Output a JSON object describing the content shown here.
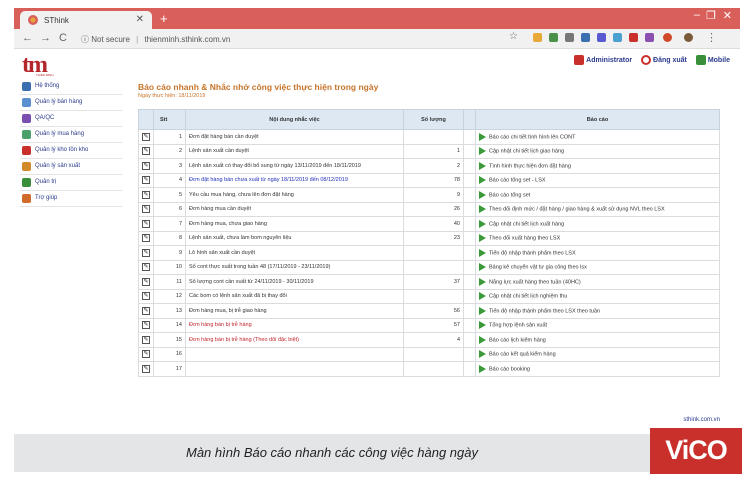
{
  "browser": {
    "tab_title": "SThink",
    "new_tab": "+",
    "nav_back": "←",
    "nav_forward": "→",
    "nav_reload": "C",
    "security": "Not secure",
    "url": "thienminh.sthink.com.vn",
    "minimize": "–",
    "restore": "❐",
    "close": "✕"
  },
  "header": {
    "logo_text": "tm",
    "logo_sub": "THIEN MINH",
    "admin": "Administrator",
    "logout": "Đăng xuất",
    "mobile": "Mobile"
  },
  "sidebar": {
    "items": [
      {
        "label": "Hệ thống",
        "icon": "tools-icon",
        "color": "#3a6fb0"
      },
      {
        "label": "Quản lý bán hàng",
        "icon": "sales-icon",
        "color": "#5a8fd0"
      },
      {
        "label": "QA/QC",
        "icon": "qaqc-icon",
        "color": "#7a4fb0"
      },
      {
        "label": "Quản lý mua hàng",
        "icon": "purchase-icon",
        "color": "#4a9f6a"
      },
      {
        "label": "Quản lý kho tồn kho",
        "icon": "warehouse-icon",
        "color": "#c9302c"
      },
      {
        "label": "Quản lý sản xuất",
        "icon": "production-icon",
        "color": "#d08a2a"
      },
      {
        "label": "Quản trị",
        "icon": "admin-icon",
        "color": "#3a8f3a"
      },
      {
        "label": "Trợ giúp",
        "icon": "help-icon",
        "color": "#d06a2a"
      }
    ]
  },
  "main": {
    "title": "Báo cáo nhanh & Nhắc nhở công việc thực hiện trong ngày",
    "subtitle": "Ngày thực hiện: 18/11/2019",
    "columns": {
      "stt": "Stt",
      "content": "Nội dung nhắc việc",
      "qty": "Số lượng",
      "report": "Báo cáo"
    },
    "rows": [
      {
        "stt": "1",
        "content": "Đơn đặt hàng bán cần duyệt",
        "qty": "",
        "report": "Báo cáo chi tiết tình hình lên CONT",
        "style": ""
      },
      {
        "stt": "2",
        "content": "Lệnh sản xuất cần duyệt",
        "qty": "1",
        "report": "Cập nhật chi tiết lịch giao hàng",
        "style": ""
      },
      {
        "stt": "3",
        "content": "Lệnh sản xuất có thay đổi bổ sung từ ngày 13/11/2019 đến 18/11/2019",
        "qty": "2",
        "report": "Tình hình thực hiện đơn đặt hàng",
        "style": ""
      },
      {
        "stt": "4",
        "content": "Đơn đặt hàng bán chưa xuất từ ngày 18/11/2019 đến 08/12/2019",
        "qty": "78",
        "report": "Báo cáo tổng set - LSX",
        "style": "blue"
      },
      {
        "stt": "5",
        "content": "Yêu cầu mua hàng, chưa lên đơn đặt hàng",
        "qty": "9",
        "report": "Báo cáo tổng set",
        "style": ""
      },
      {
        "stt": "6",
        "content": "Đơn hàng mua cần duyệt",
        "qty": "26",
        "report": "Theo dõi định mức / đặt hàng / giao hàng & xuất sử dụng NVL theo LSX",
        "style": ""
      },
      {
        "stt": "7",
        "content": "Đơn hàng mua, chưa giao hàng",
        "qty": "40",
        "report": "Cập nhật chi tiết lịch xuất hàng",
        "style": ""
      },
      {
        "stt": "8",
        "content": "Lệnh sản xuất, chưa làm bom nguyên liệu",
        "qty": "23",
        "report": "Theo dõi xuất hàng theo LSX",
        "style": ""
      },
      {
        "stt": "9",
        "content": "Lô hình sản xuất cần duyệt",
        "qty": "",
        "report": "Tiến độ nhập thành phẩm theo LSX",
        "style": ""
      },
      {
        "stt": "10",
        "content": "Số cont thực xuất trong tuần 48 (17/11/2019 - 23/11/2019)",
        "qty": "",
        "report": "Bảng kê chuyển vật tư gia công theo lsx",
        "style": ""
      },
      {
        "stt": "11",
        "content": "Số lượng cont cần xuất từ 24/11/2019 - 30/11/2019",
        "qty": "37",
        "report": "Năng lực xuất hàng theo tuần (40HC)",
        "style": ""
      },
      {
        "stt": "12",
        "content": "Các bom có lệnh sản xuất đã bị thay đổi",
        "qty": "",
        "report": "Cập nhật chi tiết lịch nghiệm thu",
        "style": ""
      },
      {
        "stt": "13",
        "content": "Đơn hàng mua, bị trễ giao hàng",
        "qty": "56",
        "report": "Tiến độ nhập thành phẩm theo LSX theo tuần",
        "style": ""
      },
      {
        "stt": "14",
        "content": "Đơn hàng bán bị trễ hàng",
        "qty": "57",
        "report": "Tổng hợp lệnh sản xuất",
        "style": "red"
      },
      {
        "stt": "15",
        "content": "Đơn hàng bán bị trễ hàng (Theo dõi đặc biệt)",
        "qty": "4",
        "report": "Báo cáo lịch kiểm hàng",
        "style": "red"
      },
      {
        "stt": "16",
        "content": "",
        "qty": "",
        "report": "Báo cáo kết quả kiểm hàng",
        "style": ""
      },
      {
        "stt": "17",
        "content": "",
        "qty": "",
        "report": "Báo cáo booking",
        "style": ""
      }
    ],
    "footer": "sthink.com.vn"
  },
  "caption": "Màn hình Báo cáo nhanh các công việc hàng ngày",
  "brand": "ViCO",
  "colors": {
    "accent": "#c8742a",
    "brand_red": "#c9302c",
    "link": "#2b3a8c",
    "header_bg": "#dde8f3"
  }
}
